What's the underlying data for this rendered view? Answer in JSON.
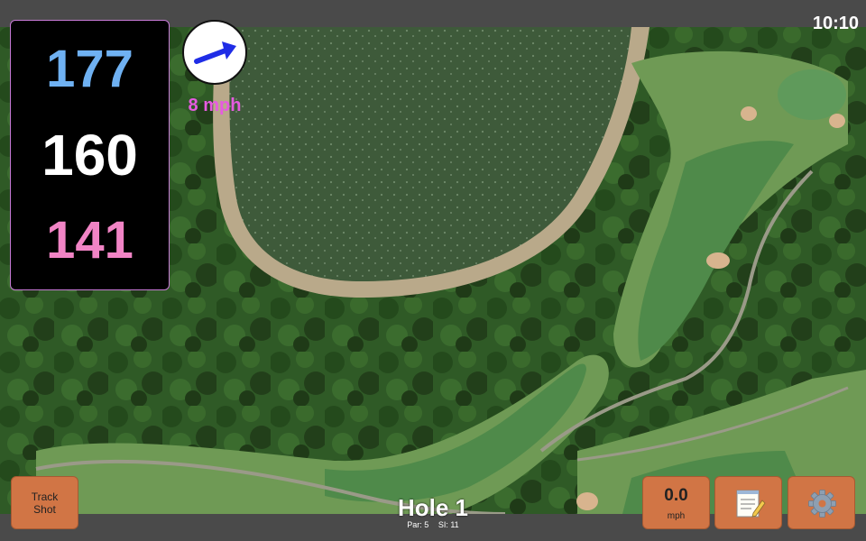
{
  "status": {
    "time": "10:10"
  },
  "distances": {
    "back": "177",
    "middle": "160",
    "front": "141",
    "colors": {
      "back": "#6fb1f2",
      "middle": "#ffffff",
      "front": "#f184c5"
    }
  },
  "wind": {
    "speed_label": "8 mph",
    "arrow_icon": "wind-arrow-icon",
    "color": "#1f2de6",
    "label_color": "#e65be0"
  },
  "hole": {
    "title": "Hole 1",
    "par_label": "Par: 5",
    "si_label": "SI: 11"
  },
  "buttons": {
    "track_shot_label": "Track Shot",
    "speed_value": "0.0",
    "speed_unit": "mph",
    "notes_icon": "notepad-icon",
    "settings_icon": "gear-icon"
  },
  "accent": "#d17545"
}
